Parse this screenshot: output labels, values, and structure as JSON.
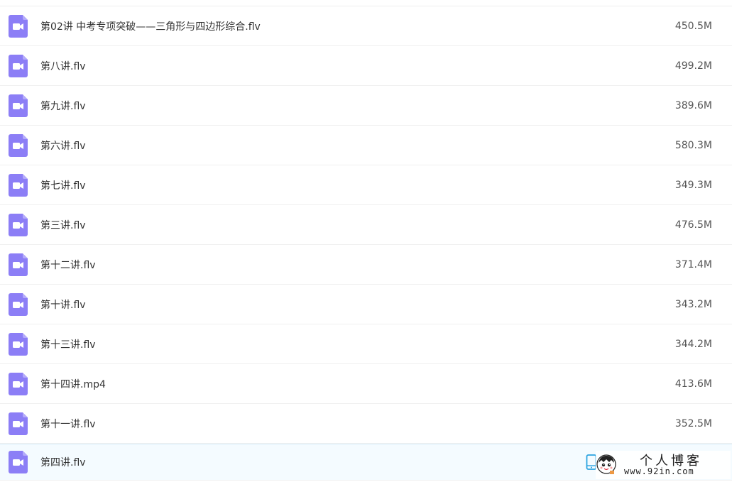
{
  "files": [
    {
      "name": "第02讲 中考专项突破——三角形与四边形综合.flv",
      "size": "450.5M",
      "icon": "video-file-icon"
    },
    {
      "name": "第八讲.flv",
      "size": "499.2M",
      "icon": "video-file-icon"
    },
    {
      "name": "第九讲.flv",
      "size": "389.6M",
      "icon": "video-file-icon"
    },
    {
      "name": "第六讲.flv",
      "size": "580.3M",
      "icon": "video-file-icon"
    },
    {
      "name": "第七讲.flv",
      "size": "349.3M",
      "icon": "video-file-icon"
    },
    {
      "name": "第三讲.flv",
      "size": "476.5M",
      "icon": "video-file-icon"
    },
    {
      "name": "第十二讲.flv",
      "size": "371.4M",
      "icon": "video-file-icon"
    },
    {
      "name": "第十讲.flv",
      "size": "343.2M",
      "icon": "video-file-icon"
    },
    {
      "name": "第十三讲.flv",
      "size": "344.2M",
      "icon": "video-file-icon"
    },
    {
      "name": "第十四讲.mp4",
      "size": "413.6M",
      "icon": "video-file-icon"
    },
    {
      "name": "第十一讲.flv",
      "size": "352.5M",
      "icon": "video-file-icon"
    },
    {
      "name": "第四讲.flv",
      "size": "",
      "icon": "video-file-icon"
    }
  ],
  "colors": {
    "icon_purple": "#8c7ef6",
    "active_row_bg": "#f4fbff",
    "phone_icon_blue": "#2aa3e0"
  },
  "watermark": {
    "title": "个人博客",
    "url": "www.92in.com"
  }
}
